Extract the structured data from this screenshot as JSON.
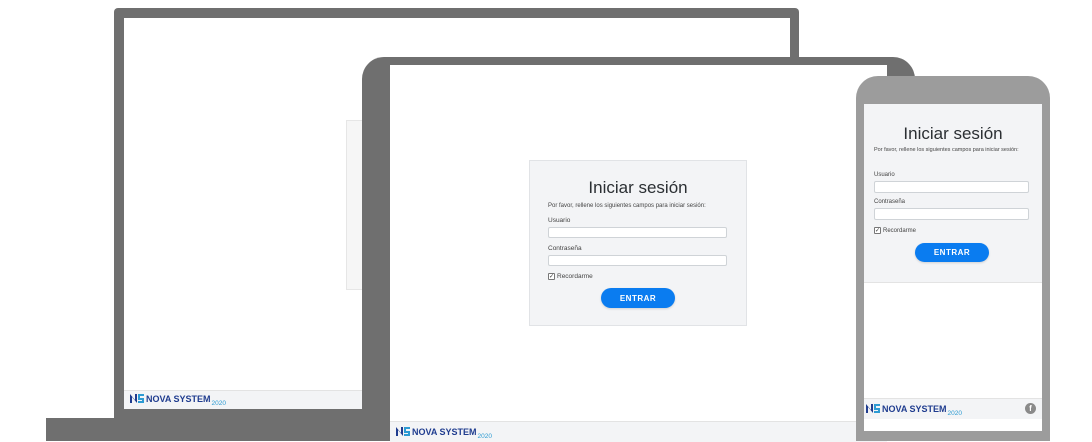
{
  "login": {
    "title": "Iniciar sesión",
    "subtitle": "Por favor, rellene los siguientes campos para iniciar sesión:",
    "username_label": "Usuario",
    "username_value": "",
    "password_label": "Contraseña",
    "password_value": "",
    "remember_label": "Recordarme",
    "remember_checked": true,
    "submit_label": "ENTRAR"
  },
  "brand": {
    "name": "NOVA SYSTEM",
    "year": "2020"
  },
  "icons": {
    "brand_mark": "ns-logo-icon",
    "checkbox": "checkbox-icon",
    "social": "facebook-icon"
  },
  "colors": {
    "device_frame": "#6f6f6f",
    "phone_frame": "#9c9c9c",
    "card_background": "#f3f4f6",
    "button": "#0a7cf0",
    "brand_dark": "#1f3c8f",
    "brand_light": "#2d9bd3"
  }
}
